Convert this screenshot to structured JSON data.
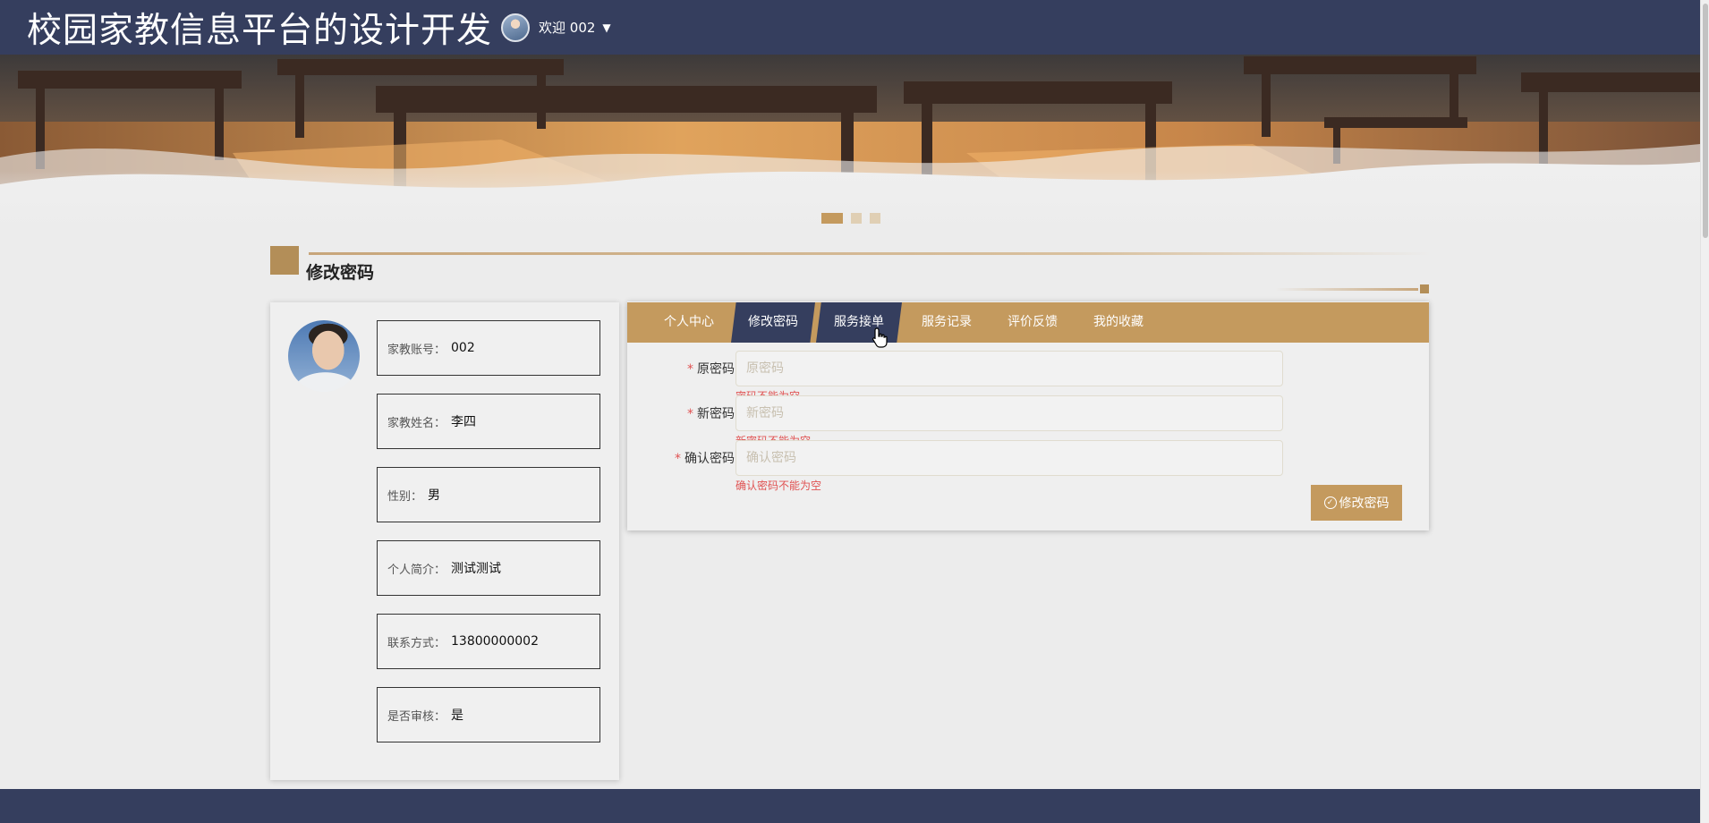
{
  "header": {
    "site_title": "校园家教信息平台的设计开发",
    "welcome": "欢迎 002",
    "user_menu_icon": "caret-down-icon"
  },
  "carousel": {
    "slides": 3,
    "active_index": 0
  },
  "section": {
    "title": "修改密码"
  },
  "profile": {
    "fields": [
      {
        "label": "家教账号：",
        "value": "002"
      },
      {
        "label": "家教姓名：",
        "value": "李四"
      },
      {
        "label": "性别：",
        "value": "男"
      },
      {
        "label": "个人简介：",
        "value": "测试测试"
      },
      {
        "label": "联系方式：",
        "value": "13800000002"
      },
      {
        "label": "是否审核：",
        "value": "是"
      }
    ]
  },
  "tabs": [
    {
      "label": "个人中心",
      "active": false
    },
    {
      "label": "修改密码",
      "active": true
    },
    {
      "label": "服务接单",
      "active": false,
      "hovered": true
    },
    {
      "label": "服务记录",
      "active": false
    },
    {
      "label": "评价反馈",
      "active": false
    },
    {
      "label": "我的收藏",
      "active": false
    }
  ],
  "form": {
    "old_password": {
      "label": "原密码",
      "placeholder": "原密码",
      "error": "密码不能为空"
    },
    "new_password": {
      "label": "新密码",
      "placeholder": "新密码",
      "error": "新密码不能为空"
    },
    "confirm_password": {
      "label": "确认密码",
      "placeholder": "确认密码",
      "error": "确认密码不能为空"
    },
    "submit_label": "修改密码"
  },
  "colors": {
    "navy": "#353e5e",
    "gold": "#c49a5e",
    "error": "#e05252",
    "background": "#ececec"
  }
}
